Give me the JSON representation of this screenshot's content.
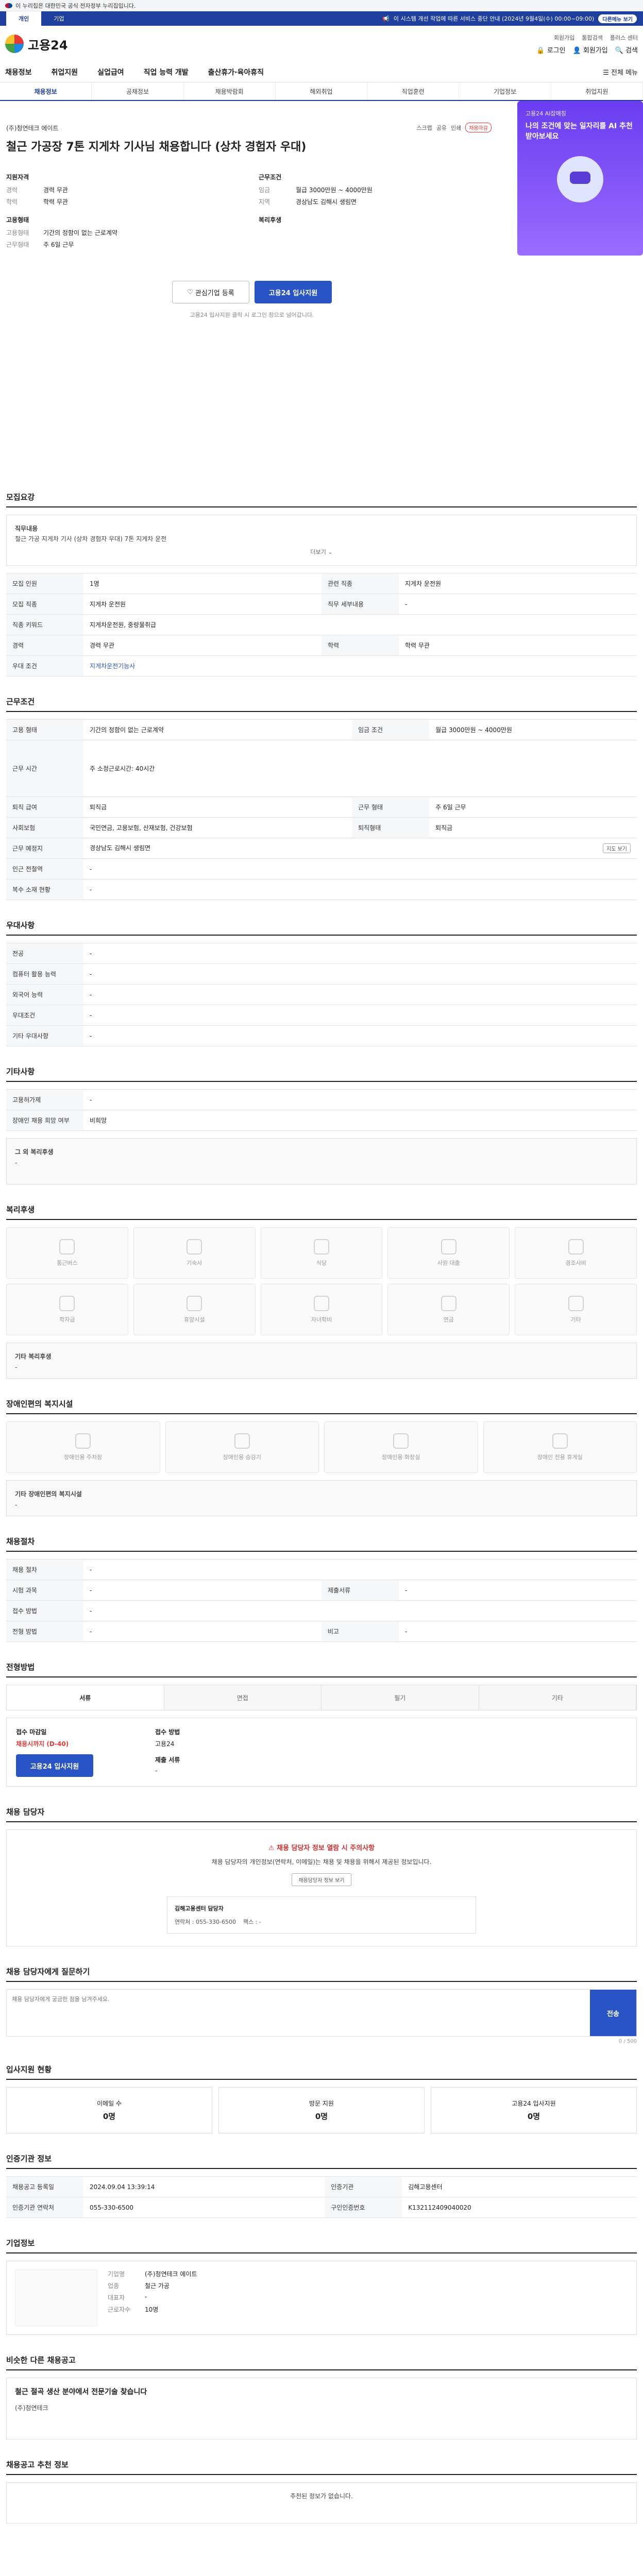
{
  "gov_bar": "이 누리집은 대한민국 공식 전자정부 누리집입니다.",
  "blue_bar": {
    "tabs": [
      "개인",
      "기업"
    ],
    "notice": "이 시스템 개선 작업에 따른 서비스 중단 안내 (2024년 9월4일(수) 00:00~09:00)",
    "badge": "다른메뉴 보기"
  },
  "header": {
    "logo": "고용24",
    "top_links": [
      "회원가입",
      "통합검색",
      "플러스 센터"
    ],
    "main_links": [
      "로그인",
      "회원가입",
      "검색"
    ]
  },
  "gnb": [
    "채용정보",
    "취업지원",
    "실업급여",
    "직업 능력 개발",
    "출산휴가·육아휴직"
  ],
  "gnb_all": "전체 메뉴",
  "subnav": [
    "채용정보",
    "공채정보",
    "채용박람회",
    "해외취업",
    "직업훈련",
    "기업정보",
    "취업지원"
  ],
  "banner": {
    "tag": "고용24 AI잡매칭",
    "title": "나의 조건에 맞는 일자리를 AI 추천받아보세요"
  },
  "job": {
    "company": "(주)청연테크 에이트",
    "title": "철근 가공장 7톤 지게차 기사님 채용합니다 (상차 경험자 우대)",
    "actions": [
      "스크랩",
      "공유",
      "인쇄"
    ],
    "hot": "채용마감",
    "left_head": "지원자격",
    "left_items": [
      {
        "k": "경력",
        "v": "경력 무관"
      },
      {
        "k": "학력",
        "v": "학력 무관"
      }
    ],
    "left_head2": "고용형태",
    "left_items2": [
      {
        "k": "고용형태",
        "v": "기간의 정함이 없는 근로계약"
      },
      {
        "k": "근무형태",
        "v": "주 6일 근무"
      }
    ],
    "right_head": "근무조건",
    "right_items": [
      {
        "k": "임금",
        "v": "월급 3000만원 ~ 4000만원"
      },
      {
        "k": "지역",
        "v": "경상남도 김해시 생림면"
      }
    ],
    "right_head2": "복리후생"
  },
  "cta": {
    "interest": "관심기업 등록",
    "apply": "고용24 입사지원",
    "note": "고용24 입사지원 클릭 시 로그인 창으로 넘어갑니다."
  },
  "recruit": {
    "title": "모집요강",
    "job_desc_head": "직무내용",
    "job_desc": "철근 가공 지게차 기사 (상차 경험자 우대) 7톤 지게차 운전",
    "more": "더보기",
    "rows": [
      {
        "k": "모집 인원",
        "v": "1명",
        "k2": "관련 직종",
        "v2": "지게차 운전원"
      },
      {
        "k": "모집 직종",
        "v": "지게차 운전원",
        "k2": "직무 세부내용",
        "v2": "-"
      },
      {
        "k": "직종 키워드",
        "v": "지게차운전원, 중량물취급",
        "k2": "",
        "v2": ""
      },
      {
        "k": "경력",
        "v": "경력 무관",
        "k2": "학력",
        "v2": "학력 무관"
      },
      {
        "k": "우대 조건",
        "v": "지게차운전기능사",
        "k2": "",
        "v2": ""
      }
    ]
  },
  "conditions": {
    "title": "근무조건",
    "rows": [
      {
        "k": "고용 형태",
        "v": "기간의 정함이 없는 근로계약",
        "k2": "임금 조건",
        "v2": "월급 3000만원 ~ 4000만원"
      },
      {
        "k": "근무 시간",
        "v": "주 소정근로시간: 40시간",
        "k2": "",
        "v2": ""
      },
      {
        "k": "퇴직 급여",
        "v": "퇴직금",
        "k2": "근무 형태",
        "v2": "주 6일 근무"
      },
      {
        "k": "사회보험",
        "v": "국민연금, 고용보험, 산재보험, 건강보험",
        "k2": "퇴직형태",
        "v2": "퇴직금"
      },
      {
        "k": "근무 예정지",
        "v": "경상남도 김해시 생림면",
        "k2": "",
        "v2": ""
      },
      {
        "k": "인근 전철역",
        "v": "-",
        "k2": "",
        "v2": ""
      },
      {
        "k": "복수 소재 현황",
        "v": "-",
        "k2": "",
        "v2": ""
      }
    ],
    "map_btn": "지도 보기"
  },
  "qualifications": {
    "title": "우대사항",
    "rows": [
      {
        "k": "전공",
        "v": "-"
      },
      {
        "k": "컴퓨터 활용 능력",
        "v": "-"
      },
      {
        "k": "외국어 능력",
        "v": "-"
      },
      {
        "k": "우대조건",
        "v": "-"
      },
      {
        "k": "기타 우대사항",
        "v": "-"
      }
    ]
  },
  "etc": {
    "title": "기타사항",
    "rows": [
      {
        "k": "고용허가제",
        "v": "-"
      },
      {
        "k": "장애인 채용 희망 여부",
        "v": "비희망"
      }
    ],
    "box_title": "그 외 복리후생",
    "box_value": "-"
  },
  "welfare": {
    "title": "복리후생",
    "tiles": [
      "통근버스",
      "기숙사",
      "식당",
      "사원 대출",
      "경조사비",
      "학자금",
      "휴양시설",
      "자녀학비",
      "연금",
      "기타"
    ],
    "box_title": "기타 복리후생",
    "box_value": "-"
  },
  "disabled": {
    "title": "장애인편의 복지시설",
    "tiles": [
      "장애인용 주차장",
      "장애인용 승강기",
      "장애인용 화장실",
      "장애인 전용 휴게실"
    ],
    "box_title": "기타 장애인편의 복지시설",
    "box_value": "-"
  },
  "selection": {
    "title": "채용절차",
    "rows": [
      {
        "k": "채용 절차",
        "v": "-",
        "k2": "",
        "v2": ""
      },
      {
        "k": "시험 과목",
        "v": "-",
        "k2": "제출서류",
        "v2": "-"
      },
      {
        "k": "접수 방법",
        "v": "-",
        "k2": "",
        "v2": ""
      },
      {
        "k": "전형 방법",
        "v": "-",
        "k2": "비고",
        "v2": "-"
      }
    ]
  },
  "apply": {
    "title": "전형방법",
    "tabs": [
      "서류",
      "면접",
      "필기",
      "기타"
    ],
    "deadline_label": "접수 마감일",
    "deadline_value": "채용시까지 (D-40)",
    "method_label": "접수 방법",
    "method_value": "고용24",
    "apply_btn": "고용24 입사지원",
    "docs_label": "제출 서류",
    "docs_value": "-"
  },
  "manager": {
    "title": "채용 담당자",
    "warn": "채용 담당자 정보 열람 시 주의사항",
    "desc": "채용 담당자의 개인정보(연락처, 이메일)는 채용 및 채용을 위해서 제공된 정보입니다.",
    "btn": "채용담당자 정보 보기",
    "org": "김해고용센터 담당자",
    "phone": "연락처 : 055-330-6500",
    "fax": "팩스 : -"
  },
  "inquiry": {
    "title": "채용 담당자에게 질문하기",
    "placeholder": "채용 담당자에게 궁금한 점을 남겨주세요.",
    "send": "전송",
    "count": "0 / 500"
  },
  "status": {
    "title": "입사지원 현황",
    "items": [
      {
        "label": "이메일 수",
        "value": "0명"
      },
      {
        "label": "방문 지원",
        "value": "0명"
      },
      {
        "label": "고용24 입사지원",
        "value": "0명"
      }
    ]
  },
  "company_info": {
    "title": "기업정보",
    "rows": [
      {
        "k": "기업명",
        "v": "(주)청연테크 에이트"
      },
      {
        "k": "업종",
        "v": "철근 가공"
      },
      {
        "k": "대표자",
        "v": "-"
      },
      {
        "k": "근로자수",
        "v": "10명"
      }
    ]
  },
  "contact": {
    "title": "인증기관 정보",
    "rows": [
      {
        "k": "채용공고 등록일",
        "v": "2024.09.04 13:39:14",
        "k2": "인증기관",
        "v2": "김해고용센터"
      },
      {
        "k": "인증기관 연락처",
        "v": "055-330-6500",
        "k2": "구인인증번호",
        "v2": "K132112409040020"
      }
    ]
  },
  "similar": {
    "title": "비슷한 다른 채용공고",
    "item_title": "철근 절곡 생산 분야에서 전문기술 찾습니다",
    "item_company": "(주)청연테크"
  },
  "bottom": {
    "title": "채용공고 추천 정보",
    "note": "추천된 정보가 없습니다."
  }
}
